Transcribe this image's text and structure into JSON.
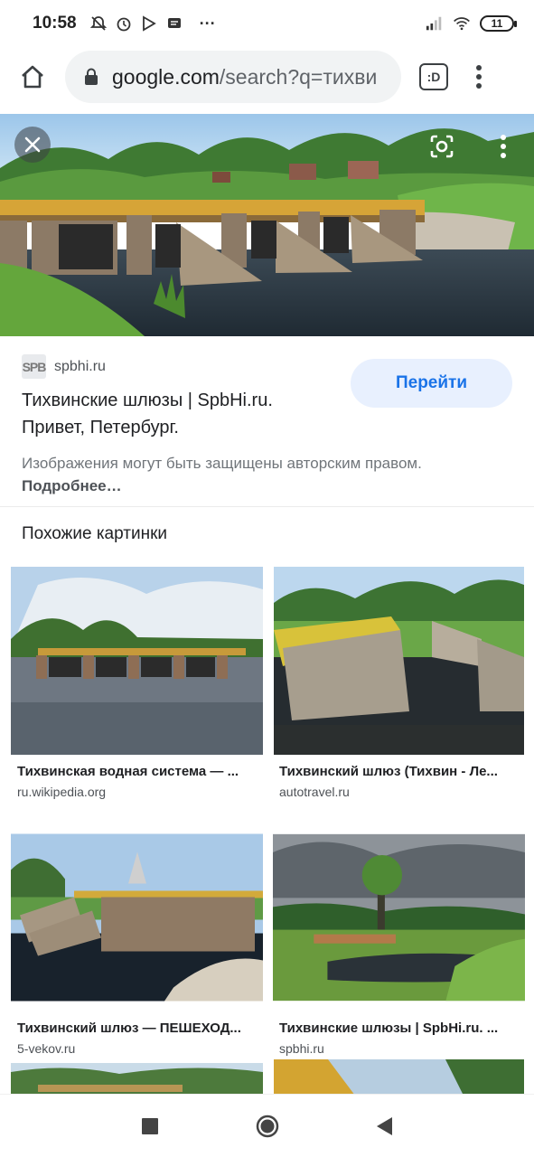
{
  "status_bar": {
    "time": "10:58",
    "more": "···",
    "battery": "11"
  },
  "browser": {
    "url_host": "google.com",
    "url_path": "/search?q=тихви",
    "tabs_label": ":D"
  },
  "preview": {
    "source_favicon": "SPB",
    "source_domain": "spbhi.ru",
    "title": "Тихвинские шлюзы | SpbHi.ru. Привет, Петербург.",
    "visit_button": "Перейти",
    "notice": "Изображения могут быть защищены авторским правом.",
    "notice_link": "Подробнее…"
  },
  "related": {
    "heading": "Похожие картинки",
    "items": [
      {
        "title": "Тихвинская водная система — ...",
        "domain": "ru.wikipedia.org"
      },
      {
        "title": "Тихвинский шлюз (Тихвин - Ле...",
        "domain": "autotravel.ru"
      },
      {
        "title": "Тихвинский шлюз — ПЕШЕХОД...",
        "domain": "5-vekov.ru"
      },
      {
        "title": "Тихвинские шлюзы | SpbHi.ru. ...",
        "domain": "spbhi.ru"
      }
    ]
  },
  "icons": {
    "home": "home-icon",
    "lock": "lock-icon",
    "menu": "more-vert-icon",
    "close": "close-icon",
    "lens": "google-lens-icon",
    "nav_recents": "square-icon",
    "nav_home": "circle-icon",
    "nav_back": "triangle-back-icon"
  },
  "colors": {
    "accent": "#1a73e8",
    "button_bg": "#e8f0fe",
    "omnibox_bg": "#f1f3f4"
  }
}
